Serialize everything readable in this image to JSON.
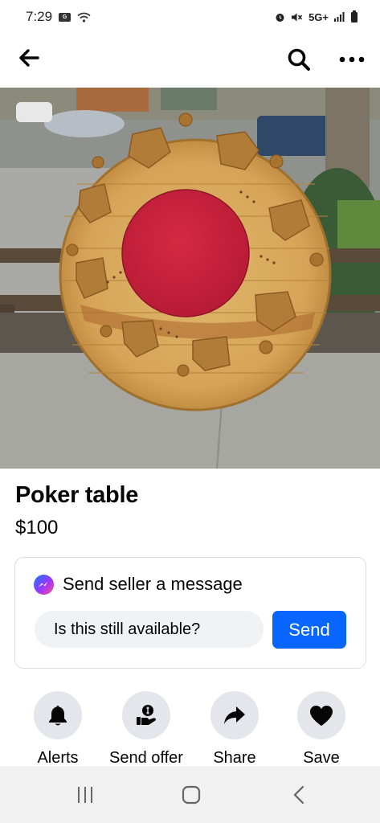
{
  "status_bar": {
    "time": "7:29",
    "network": "5G+",
    "icons": [
      "gallery-icon",
      "wifi-icon",
      "alarm-icon",
      "mute-icon",
      "signal-icon",
      "battery-icon"
    ]
  },
  "app_bar": {
    "back_icon": "arrow-left-icon",
    "search_icon": "search-icon",
    "more_icon": "more-horizontal-icon"
  },
  "listing": {
    "title": "Poker table",
    "price": "$100"
  },
  "message": {
    "header": "Send seller a message",
    "input_value": "Is this still available?",
    "send_label": "Send"
  },
  "actions": [
    {
      "label": "Alerts",
      "icon": "bell-icon"
    },
    {
      "label": "Send offer",
      "icon": "offer-icon"
    },
    {
      "label": "Share",
      "icon": "share-arrow-icon"
    },
    {
      "label": "Save",
      "icon": "heart-icon"
    }
  ],
  "nav_bar": {
    "icons": [
      "recent-apps-icon",
      "home-icon",
      "back-icon"
    ]
  },
  "colors": {
    "accent": "#0866ff",
    "action_circle": "#e4e6eb",
    "input_bg": "#f0f2f5",
    "felt_red": "#c8203c"
  }
}
